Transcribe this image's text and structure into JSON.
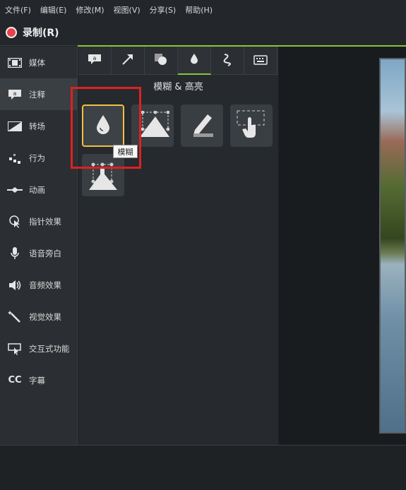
{
  "menu": [
    "文件(F)",
    "编辑(E)",
    "修改(M)",
    "视图(V)",
    "分享(S)",
    "帮助(H)"
  ],
  "record": {
    "label": "录制(R)"
  },
  "sidebar": {
    "items": [
      {
        "label": "媒体",
        "icon": "film-icon"
      },
      {
        "label": "注释",
        "icon": "annotation-icon"
      },
      {
        "label": "转场",
        "icon": "transition-icon"
      },
      {
        "label": "行为",
        "icon": "behavior-icon"
      },
      {
        "label": "动画",
        "icon": "animation-icon"
      },
      {
        "label": "指针效果",
        "icon": "cursor-effect-icon"
      },
      {
        "label": "语音旁白",
        "icon": "microphone-icon"
      },
      {
        "label": "音频效果",
        "icon": "speaker-icon"
      },
      {
        "label": "视觉效果",
        "icon": "magic-wand-icon"
      },
      {
        "label": "交互式功能",
        "icon": "interactive-icon"
      },
      {
        "label": "字幕",
        "icon": "cc-icon"
      }
    ],
    "active_index": 1
  },
  "tools": {
    "section_title": "模糊 & 高亮",
    "tabs": [
      "callout-tab-icon",
      "arrow-tab-icon",
      "shape-tab-icon",
      "blur-tab-icon",
      "sketch-tab-icon",
      "keystroke-tab-icon"
    ],
    "active_tab": 3,
    "tooltip": "模糊"
  },
  "colors": {
    "accent": "#8cc23f",
    "record": "#e8414b",
    "highlight": "#e02020",
    "selected": "#f0c040"
  }
}
